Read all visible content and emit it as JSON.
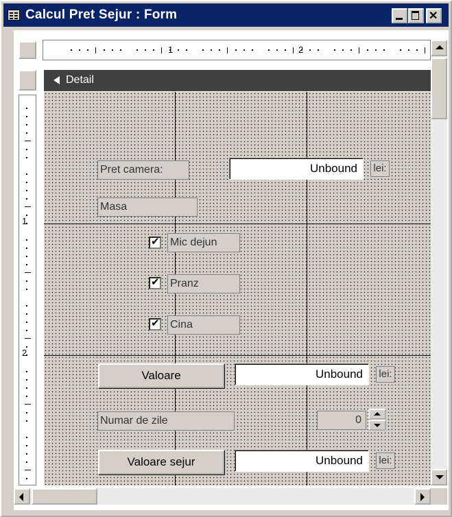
{
  "window": {
    "title": "Calcul Pret Sejur : Form"
  },
  "ruler": {
    "h_labels": [
      "1",
      "2"
    ],
    "v_labels": [
      "1",
      "2"
    ]
  },
  "section": {
    "label": "Detail"
  },
  "fields": {
    "pret_camera": {
      "label": "Pret camera:",
      "value": "Unbound",
      "unit": "lei:"
    },
    "masa": {
      "label": "Masa"
    },
    "mic_dejun": {
      "label": "Mic dejun",
      "checked": true
    },
    "pranz": {
      "label": "Pranz",
      "checked": true
    },
    "cina": {
      "label": "Cina",
      "checked": true
    },
    "valoare": {
      "button": "Valoare",
      "value": "Unbound",
      "unit": "lei:"
    },
    "numar_zile": {
      "label": "Numar de zile",
      "value": "0"
    },
    "valoare_sejur": {
      "button": "Valoare sejur",
      "value": "Unbound",
      "unit": "lei:"
    }
  },
  "icons": [
    "form-icon",
    "minimize-icon",
    "maximize-icon",
    "close-icon",
    "section-arrow-icon",
    "check-icon",
    "spin-up-icon",
    "spin-down-icon",
    "scroll-up-icon",
    "scroll-down-icon",
    "scroll-left-icon",
    "scroll-right-icon"
  ],
  "colors": {
    "titlebar": "#0a246a",
    "window": "#d4d0c8",
    "section_header": "#404040"
  }
}
